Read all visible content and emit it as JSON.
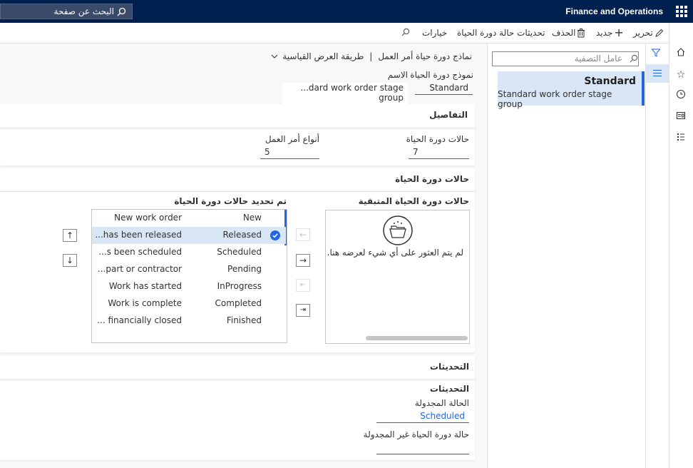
{
  "header": {
    "search_text": "البحث عن صفحة",
    "brand": "Finance and Operations"
  },
  "actionbar": {
    "edit": "تحرير",
    "new": "جديد",
    "delete": "الحذف",
    "updates": "تحديثات حالة دورة الحياة",
    "options": "خيارات"
  },
  "listpane": {
    "filter_placeholder": "عامل التصفية",
    "selected_title": "Standard",
    "selected_subtitle": "Standard work order stage group"
  },
  "page": {
    "breadcrumb": "نماذج دورة حياة أمر العمل",
    "separator": "|",
    "view": "طريقة العرض القياسية",
    "col_model": "نموذج دورة الحياة",
    "col_name": "الاسم",
    "model_value": "Standard",
    "name_value": "...dard work order stage group"
  },
  "details": {
    "title": "التفاصيل",
    "states_label": "حالات دورة الحياة",
    "states_value": "7",
    "types_label": "أنواع أمر العمل",
    "types_value": "5"
  },
  "lifecycle": {
    "title": "حالات دورة الحياة",
    "remaining_title": "حالات دورة الحياة المتبقية",
    "selected_title": "تم تحديد حالات دورة الحياة",
    "empty_text": "لم يتم العثور على أي شيء لعرضه هنا.",
    "rows": [
      {
        "state": "New",
        "desc": "New work order"
      },
      {
        "state": "Released",
        "desc": "...has been released"
      },
      {
        "state": "Scheduled",
        "desc": "...s been scheduled"
      },
      {
        "state": "Pending",
        "desc": "...part or contractor"
      },
      {
        "state": "InProgress",
        "desc": "Work has started"
      },
      {
        "state": "Completed",
        "desc": "Work is complete"
      },
      {
        "state": "Finished",
        "desc": "... financially closed"
      }
    ],
    "selected_row": 1
  },
  "updates": {
    "title": "التحديثات",
    "subtitle": "التحديثات",
    "scheduled_label": "الحالة المجدولة",
    "scheduled_value": "Scheduled",
    "unscheduled_label": "حالة دورة الحياة غير المجدولة",
    "unscheduled_value": ""
  },
  "colors": {
    "topbar": "#002050",
    "accent": "#2266e3",
    "selection": "#d9e6f5"
  }
}
